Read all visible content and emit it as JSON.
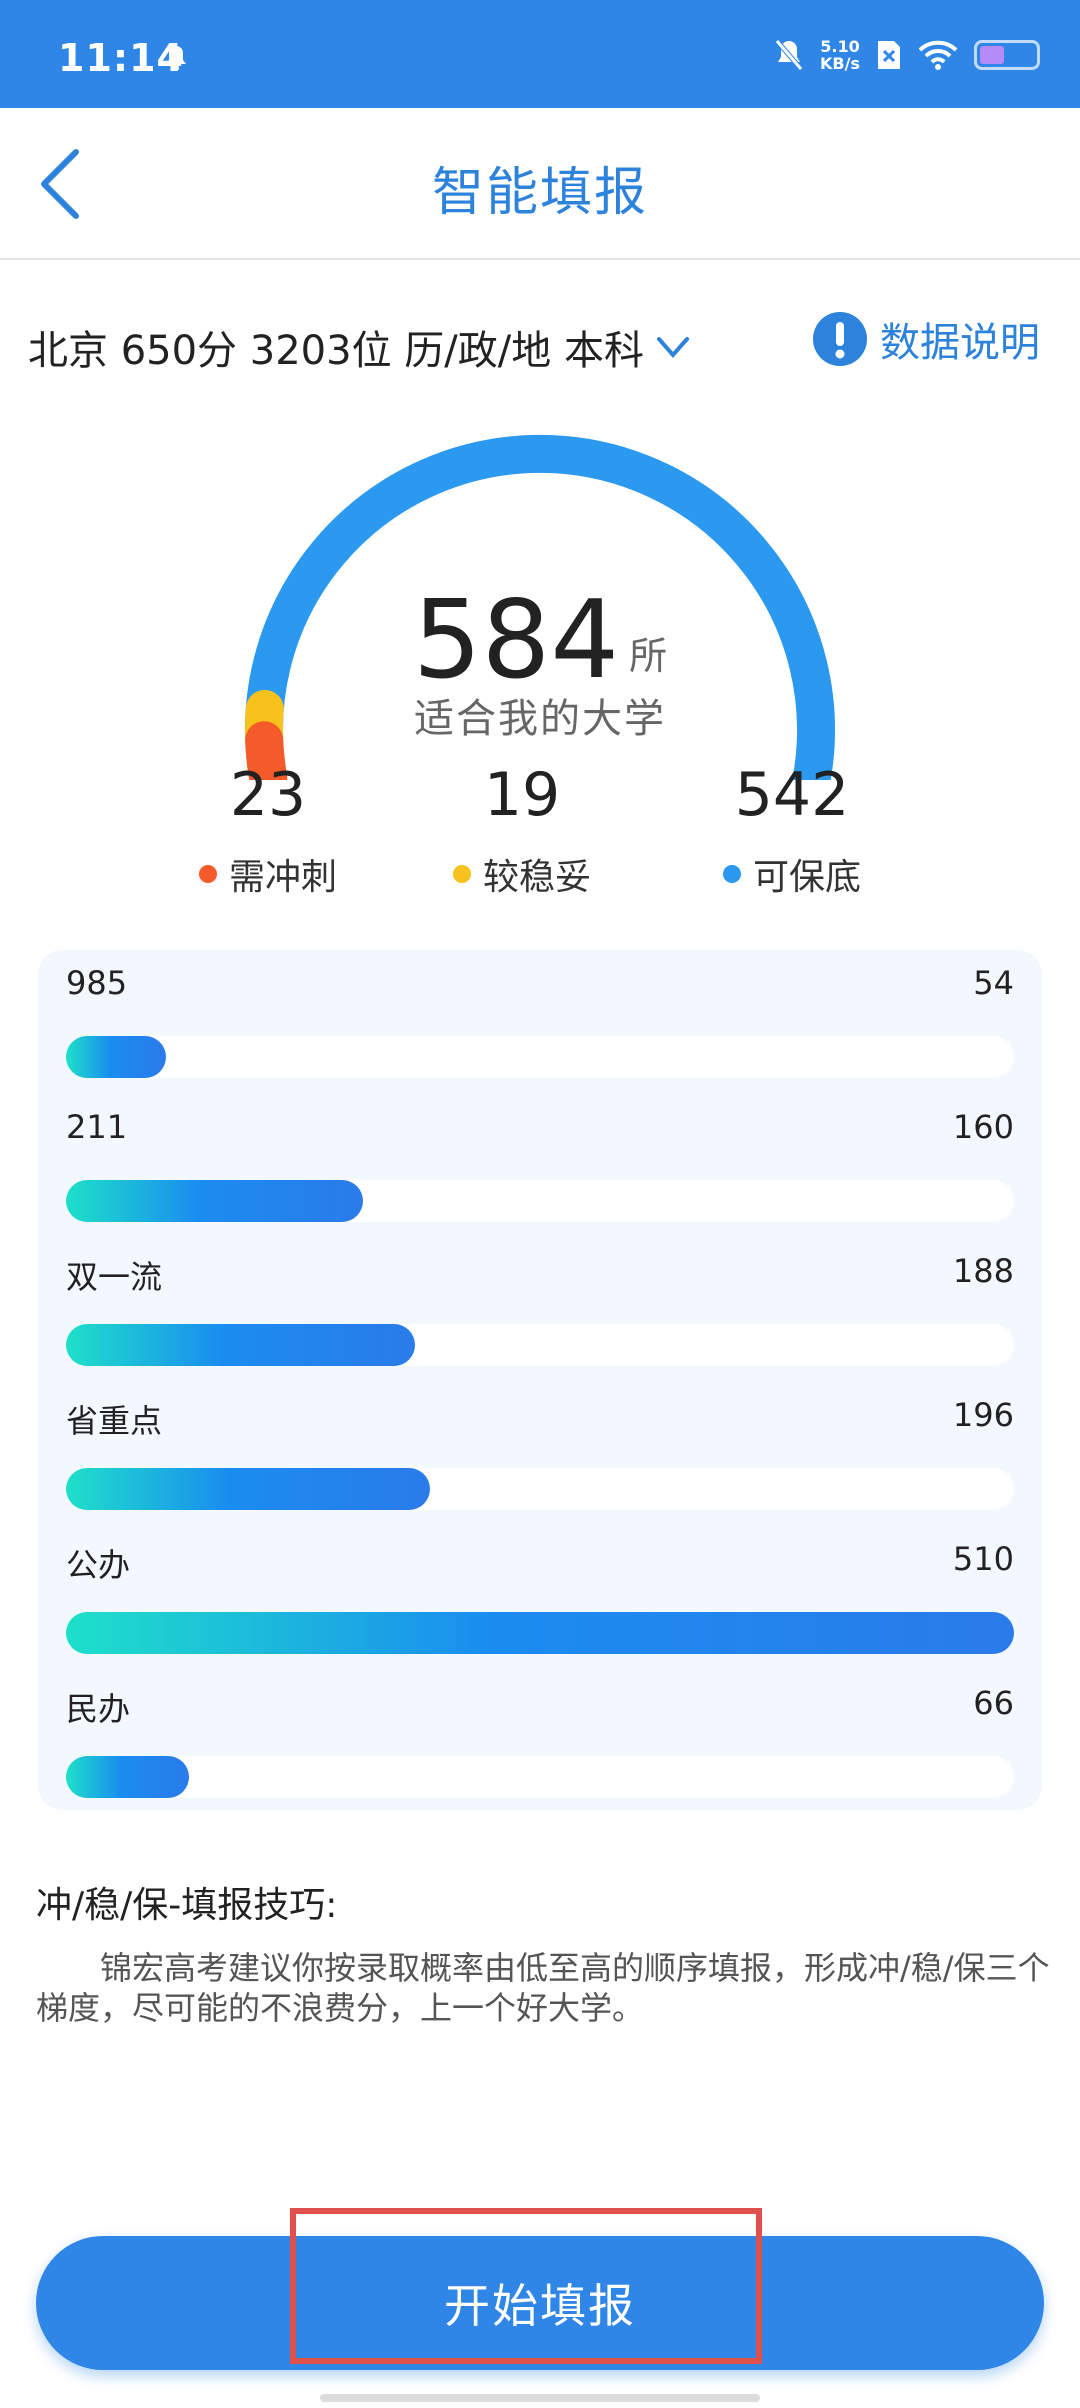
{
  "status_bar": {
    "time": "11:14",
    "net_speed_value": "5.10",
    "net_speed_unit": "KB/s",
    "battery_level": 0.45
  },
  "header": {
    "title": "智能填报"
  },
  "filter": {
    "summary": "北京 650分 3203位 历/政/地 本科",
    "data_note": "数据说明"
  },
  "gauge": {
    "total": "584",
    "unit": "所",
    "caption": "适合我的大学",
    "stats": [
      {
        "value": 23,
        "label": "需冲刺",
        "color": "#f45a2a"
      },
      {
        "value": 19,
        "label": "较稳妥",
        "color": "#f7c21b"
      },
      {
        "value": 542,
        "label": "可保底",
        "color": "#2b99ef"
      }
    ]
  },
  "bars": [
    {
      "name": "985",
      "count": 54
    },
    {
      "name": "211",
      "count": 160
    },
    {
      "name": "双一流",
      "count": 188
    },
    {
      "name": "省重点",
      "count": 196
    },
    {
      "name": "公办",
      "count": 510
    },
    {
      "name": "民办",
      "count": 66
    }
  ],
  "tips": {
    "title": "冲/稳/保-填报技巧:",
    "body": "锦宏高考建议你按录取概率由低至高的顺序填报，形成冲/稳/保三个梯度，尽可能的不浪费分，上一个好大学。"
  },
  "actions": {
    "start_label": "开始填报"
  },
  "colors": {
    "primary": "#2f86e6",
    "title_blue": "#2d82db",
    "highlight": "#e0504d"
  }
}
